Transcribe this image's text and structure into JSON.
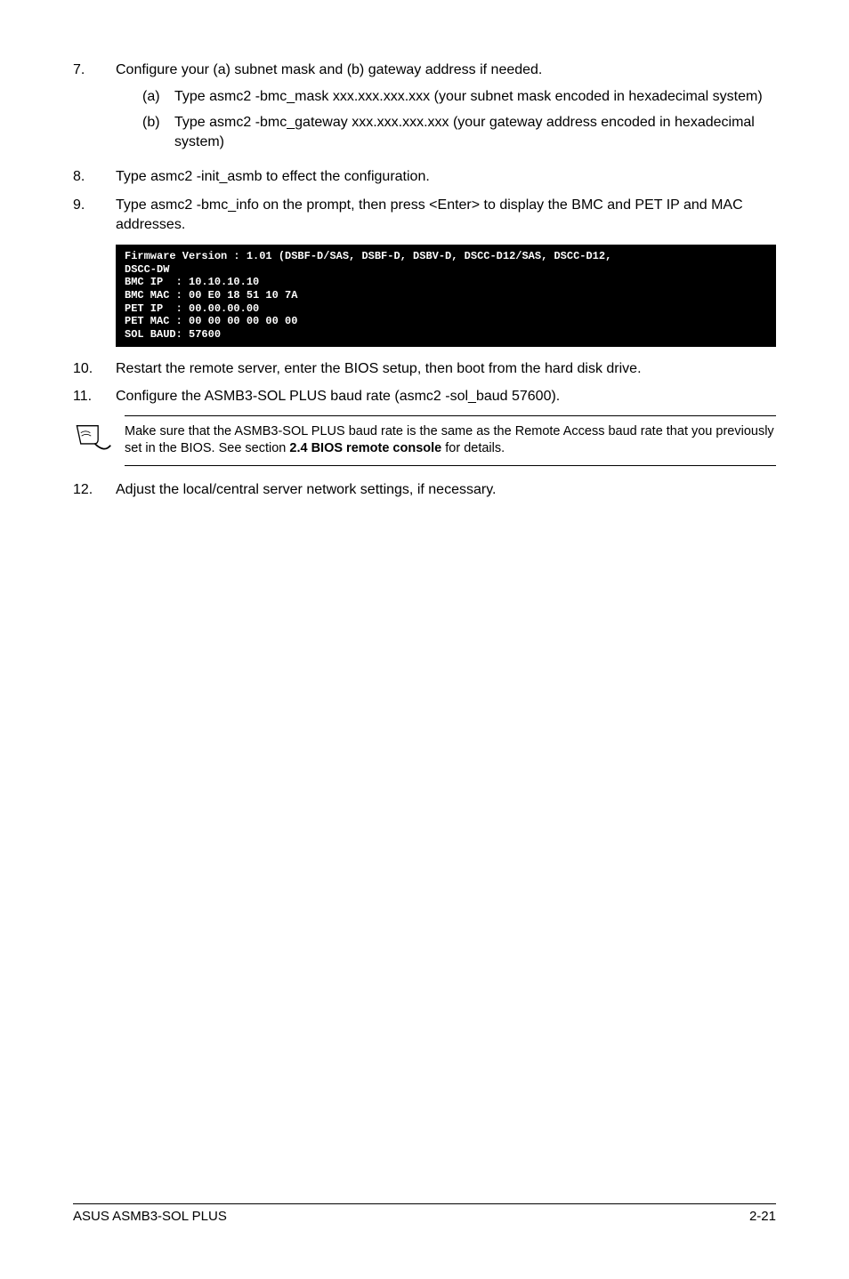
{
  "steps": {
    "s7": {
      "num": "7.",
      "text": "Configure your (a) subnet mask and (b) gateway address if needed.",
      "a": {
        "let": "(a)",
        "text": "Type asmc2 -bmc_mask xxx.xxx.xxx.xxx (your subnet mask encoded in hexadecimal system)"
      },
      "b": {
        "let": "(b)",
        "text": "Type asmc2 -bmc_gateway xxx.xxx.xxx.xxx (your gateway address encoded in hexadecimal system)"
      }
    },
    "s8": {
      "num": "8.",
      "text": "Type asmc2 -init_asmb to effect the configuration."
    },
    "s9": {
      "num": "9.",
      "text": "Type asmc2 -bmc_info on the prompt, then press <Enter> to display the BMC and PET IP and MAC addresses."
    },
    "s10": {
      "num": "10.",
      "text": "Restart the remote server, enter the BIOS setup, then boot from the hard disk drive."
    },
    "s11": {
      "num": "11.",
      "text": "Configure the ASMB3-SOL PLUS baud rate (asmc2 -sol_baud 57600)."
    },
    "s12": {
      "num": "12.",
      "text": "Adjust the local/central server network settings, if necessary."
    }
  },
  "terminal": "Firmware Version : 1.01 (DSBF-D/SAS, DSBF-D, DSBV-D, DSCC-D12/SAS, DSCC-D12,\nDSCC-DW\nBMC IP  : 10.10.10.10\nBMC MAC : 00 E0 18 51 10 7A\nPET IP  : 00.00.00.00\nPET MAC : 00 00 00 00 00 00\nSOL BAUD: 57600",
  "note": {
    "part1": "Make sure that the ASMB3-SOL PLUS baud rate is the same as the Remote Access baud rate that you previously set in the BIOS. See section ",
    "bold": "2.4 BIOS remote console",
    "part2": " for details."
  },
  "footer": {
    "left": "ASUS ASMB3-SOL PLUS",
    "right": "2-21"
  }
}
